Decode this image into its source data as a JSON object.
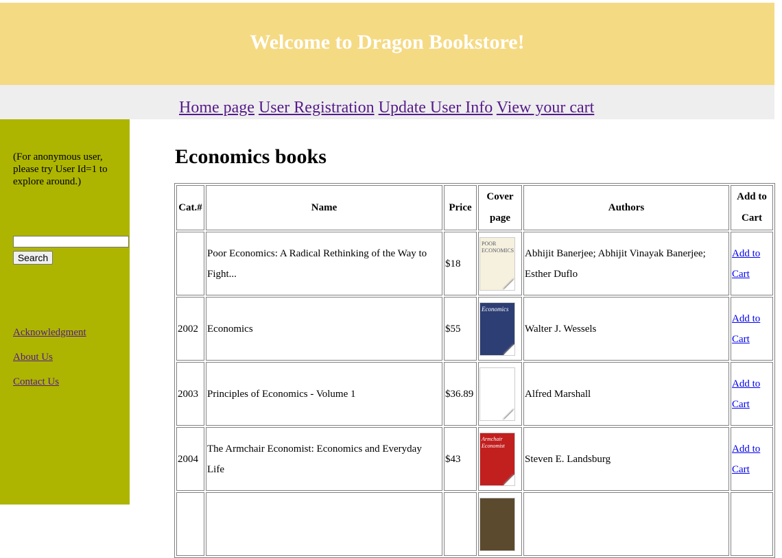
{
  "header": {
    "title": "Welcome to Dragon Bookstore!",
    "bg_color": "#f5da84"
  },
  "nav": {
    "links": [
      "Home page",
      "User Registration",
      "Update User Info",
      "View your cart"
    ]
  },
  "sidebar": {
    "bg_color": "#adb500",
    "anon_note": "(For anonymous user, please try User Id=1 to explore around.)",
    "search_value": "",
    "search_button": "Search",
    "links": [
      "Acknowledgment",
      "About Us",
      "Contact Us"
    ]
  },
  "main": {
    "title": "Economics books",
    "columns": [
      "Cat.#",
      "Name",
      "Price",
      "Cover page",
      "Authors",
      "Add to Cart"
    ],
    "rows": [
      {
        "cat": "",
        "name": "Poor Economics: A Radical Rethinking of the Way to Fight...",
        "price": "$18",
        "cover_text": "POOR ECONOMICS",
        "authors": "Abhijit Banerjee; Abhijit Vinayak Banerjee; Esther Duflo",
        "cart": "Add to Cart"
      },
      {
        "cat": "2002",
        "name": "Economics",
        "price": "$55",
        "cover_text": "Economics",
        "authors": "Walter J. Wessels",
        "cart": "Add to Cart"
      },
      {
        "cat": "2003",
        "name": "Principles of Economics - Volume 1",
        "price": "$36.89",
        "cover_text": "",
        "authors": "Alfred Marshall",
        "cart": "Add to Cart"
      },
      {
        "cat": "2004",
        "name": "The Armchair Economist: Economics and Everyday Life",
        "price": "$43",
        "cover_text": "Armchair Economist",
        "authors": "Steven E. Landsburg",
        "cart": "Add to Cart"
      },
      {
        "cat": "",
        "name": "",
        "price": "",
        "cover_text": "",
        "authors": "",
        "cart": ""
      }
    ]
  }
}
